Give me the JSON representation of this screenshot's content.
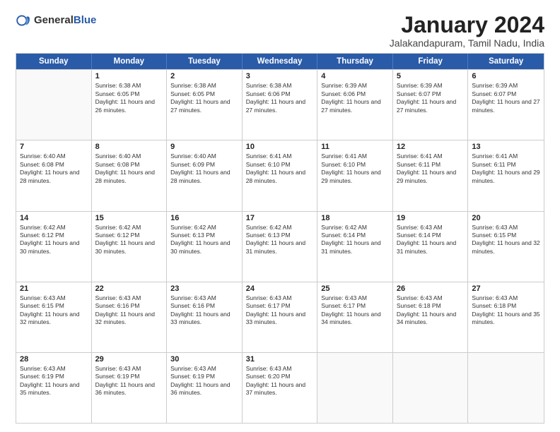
{
  "header": {
    "logo_general": "General",
    "logo_blue": "Blue",
    "month_title": "January 2024",
    "location": "Jalakandapuram, Tamil Nadu, India"
  },
  "calendar": {
    "days_of_week": [
      "Sunday",
      "Monday",
      "Tuesday",
      "Wednesday",
      "Thursday",
      "Friday",
      "Saturday"
    ],
    "weeks": [
      [
        {
          "day": "",
          "sunrise": "",
          "sunset": "",
          "daylight": ""
        },
        {
          "day": "1",
          "sunrise": "Sunrise: 6:38 AM",
          "sunset": "Sunset: 6:05 PM",
          "daylight": "Daylight: 11 hours and 26 minutes."
        },
        {
          "day": "2",
          "sunrise": "Sunrise: 6:38 AM",
          "sunset": "Sunset: 6:05 PM",
          "daylight": "Daylight: 11 hours and 27 minutes."
        },
        {
          "day": "3",
          "sunrise": "Sunrise: 6:38 AM",
          "sunset": "Sunset: 6:06 PM",
          "daylight": "Daylight: 11 hours and 27 minutes."
        },
        {
          "day": "4",
          "sunrise": "Sunrise: 6:39 AM",
          "sunset": "Sunset: 6:06 PM",
          "daylight": "Daylight: 11 hours and 27 minutes."
        },
        {
          "day": "5",
          "sunrise": "Sunrise: 6:39 AM",
          "sunset": "Sunset: 6:07 PM",
          "daylight": "Daylight: 11 hours and 27 minutes."
        },
        {
          "day": "6",
          "sunrise": "Sunrise: 6:39 AM",
          "sunset": "Sunset: 6:07 PM",
          "daylight": "Daylight: 11 hours and 27 minutes."
        }
      ],
      [
        {
          "day": "7",
          "sunrise": "Sunrise: 6:40 AM",
          "sunset": "Sunset: 6:08 PM",
          "daylight": "Daylight: 11 hours and 28 minutes."
        },
        {
          "day": "8",
          "sunrise": "Sunrise: 6:40 AM",
          "sunset": "Sunset: 6:08 PM",
          "daylight": "Daylight: 11 hours and 28 minutes."
        },
        {
          "day": "9",
          "sunrise": "Sunrise: 6:40 AM",
          "sunset": "Sunset: 6:09 PM",
          "daylight": "Daylight: 11 hours and 28 minutes."
        },
        {
          "day": "10",
          "sunrise": "Sunrise: 6:41 AM",
          "sunset": "Sunset: 6:10 PM",
          "daylight": "Daylight: 11 hours and 28 minutes."
        },
        {
          "day": "11",
          "sunrise": "Sunrise: 6:41 AM",
          "sunset": "Sunset: 6:10 PM",
          "daylight": "Daylight: 11 hours and 29 minutes."
        },
        {
          "day": "12",
          "sunrise": "Sunrise: 6:41 AM",
          "sunset": "Sunset: 6:11 PM",
          "daylight": "Daylight: 11 hours and 29 minutes."
        },
        {
          "day": "13",
          "sunrise": "Sunrise: 6:41 AM",
          "sunset": "Sunset: 6:11 PM",
          "daylight": "Daylight: 11 hours and 29 minutes."
        }
      ],
      [
        {
          "day": "14",
          "sunrise": "Sunrise: 6:42 AM",
          "sunset": "Sunset: 6:12 PM",
          "daylight": "Daylight: 11 hours and 30 minutes."
        },
        {
          "day": "15",
          "sunrise": "Sunrise: 6:42 AM",
          "sunset": "Sunset: 6:12 PM",
          "daylight": "Daylight: 11 hours and 30 minutes."
        },
        {
          "day": "16",
          "sunrise": "Sunrise: 6:42 AM",
          "sunset": "Sunset: 6:13 PM",
          "daylight": "Daylight: 11 hours and 30 minutes."
        },
        {
          "day": "17",
          "sunrise": "Sunrise: 6:42 AM",
          "sunset": "Sunset: 6:13 PM",
          "daylight": "Daylight: 11 hours and 31 minutes."
        },
        {
          "day": "18",
          "sunrise": "Sunrise: 6:42 AM",
          "sunset": "Sunset: 6:14 PM",
          "daylight": "Daylight: 11 hours and 31 minutes."
        },
        {
          "day": "19",
          "sunrise": "Sunrise: 6:43 AM",
          "sunset": "Sunset: 6:14 PM",
          "daylight": "Daylight: 11 hours and 31 minutes."
        },
        {
          "day": "20",
          "sunrise": "Sunrise: 6:43 AM",
          "sunset": "Sunset: 6:15 PM",
          "daylight": "Daylight: 11 hours and 32 minutes."
        }
      ],
      [
        {
          "day": "21",
          "sunrise": "Sunrise: 6:43 AM",
          "sunset": "Sunset: 6:15 PM",
          "daylight": "Daylight: 11 hours and 32 minutes."
        },
        {
          "day": "22",
          "sunrise": "Sunrise: 6:43 AM",
          "sunset": "Sunset: 6:16 PM",
          "daylight": "Daylight: 11 hours and 32 minutes."
        },
        {
          "day": "23",
          "sunrise": "Sunrise: 6:43 AM",
          "sunset": "Sunset: 6:16 PM",
          "daylight": "Daylight: 11 hours and 33 minutes."
        },
        {
          "day": "24",
          "sunrise": "Sunrise: 6:43 AM",
          "sunset": "Sunset: 6:17 PM",
          "daylight": "Daylight: 11 hours and 33 minutes."
        },
        {
          "day": "25",
          "sunrise": "Sunrise: 6:43 AM",
          "sunset": "Sunset: 6:17 PM",
          "daylight": "Daylight: 11 hours and 34 minutes."
        },
        {
          "day": "26",
          "sunrise": "Sunrise: 6:43 AM",
          "sunset": "Sunset: 6:18 PM",
          "daylight": "Daylight: 11 hours and 34 minutes."
        },
        {
          "day": "27",
          "sunrise": "Sunrise: 6:43 AM",
          "sunset": "Sunset: 6:18 PM",
          "daylight": "Daylight: 11 hours and 35 minutes."
        }
      ],
      [
        {
          "day": "28",
          "sunrise": "Sunrise: 6:43 AM",
          "sunset": "Sunset: 6:19 PM",
          "daylight": "Daylight: 11 hours and 35 minutes."
        },
        {
          "day": "29",
          "sunrise": "Sunrise: 6:43 AM",
          "sunset": "Sunset: 6:19 PM",
          "daylight": "Daylight: 11 hours and 36 minutes."
        },
        {
          "day": "30",
          "sunrise": "Sunrise: 6:43 AM",
          "sunset": "Sunset: 6:19 PM",
          "daylight": "Daylight: 11 hours and 36 minutes."
        },
        {
          "day": "31",
          "sunrise": "Sunrise: 6:43 AM",
          "sunset": "Sunset: 6:20 PM",
          "daylight": "Daylight: 11 hours and 37 minutes."
        },
        {
          "day": "",
          "sunrise": "",
          "sunset": "",
          "daylight": ""
        },
        {
          "day": "",
          "sunrise": "",
          "sunset": "",
          "daylight": ""
        },
        {
          "day": "",
          "sunrise": "",
          "sunset": "",
          "daylight": ""
        }
      ]
    ]
  }
}
